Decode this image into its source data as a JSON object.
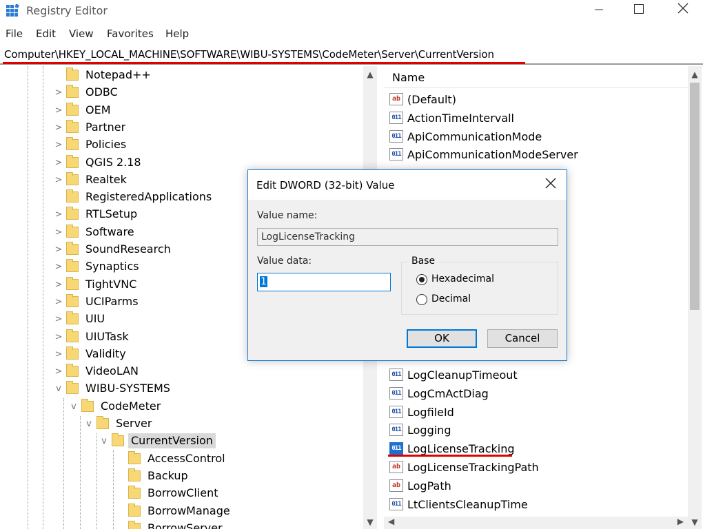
{
  "window": {
    "title": "Registry Editor"
  },
  "menu": [
    "File",
    "Edit",
    "View",
    "Favorites",
    "Help"
  ],
  "address": "Computer\\HKEY_LOCAL_MACHINE\\SOFTWARE\\WIBU-SYSTEMS\\CodeMeter\\Server\\CurrentVersion",
  "tree": {
    "items": [
      {
        "label": "Notepad++",
        "expander": ""
      },
      {
        "label": "ODBC",
        "expander": ">"
      },
      {
        "label": "OEM",
        "expander": ">"
      },
      {
        "label": "Partner",
        "expander": ">"
      },
      {
        "label": "Policies",
        "expander": ">"
      },
      {
        "label": "QGIS 2.18",
        "expander": ">"
      },
      {
        "label": "Realtek",
        "expander": ">"
      },
      {
        "label": "RegisteredApplications",
        "expander": ""
      },
      {
        "label": "RTLSetup",
        "expander": ">"
      },
      {
        "label": "Software",
        "expander": ">"
      },
      {
        "label": "SoundResearch",
        "expander": ">"
      },
      {
        "label": "Synaptics",
        "expander": ">"
      },
      {
        "label": "TightVNC",
        "expander": ">"
      },
      {
        "label": "UCIParms",
        "expander": ">"
      },
      {
        "label": "UIU",
        "expander": ">"
      },
      {
        "label": "UIUTask",
        "expander": ">"
      },
      {
        "label": "Validity",
        "expander": ">"
      },
      {
        "label": "VideoLAN",
        "expander": ">"
      },
      {
        "label": "WIBU-SYSTEMS",
        "expander": "v"
      },
      {
        "label": "CodeMeter",
        "expander": "v"
      },
      {
        "label": "Server",
        "expander": "v"
      },
      {
        "label": "CurrentVersion",
        "expander": "v",
        "selected": true
      },
      {
        "label": "AccessControl",
        "expander": ""
      },
      {
        "label": "Backup",
        "expander": ""
      },
      {
        "label": "BorrowClient",
        "expander": ""
      },
      {
        "label": "BorrowManage",
        "expander": ""
      },
      {
        "label": "BorrowServer",
        "expander": ""
      }
    ]
  },
  "list": {
    "header_name": "Name",
    "top_items": [
      {
        "name": "(Default)",
        "icon": "string-value-icon",
        "glyph": "ab"
      },
      {
        "name": "ActionTimeIntervall",
        "icon": "binary-value-icon",
        "glyph": "011"
      },
      {
        "name": "ApiCommunicationMode",
        "icon": "binary-value-icon",
        "glyph": "011"
      },
      {
        "name": "ApiCommunicationModeServer",
        "icon": "binary-value-icon",
        "glyph": "011"
      }
    ],
    "bottom_items": [
      {
        "name": "LogCleanupTimeout",
        "icon": "binary-value-icon",
        "glyph": "011"
      },
      {
        "name": "LogCmActDiag",
        "icon": "binary-value-icon",
        "glyph": "011"
      },
      {
        "name": "LogfileId",
        "icon": "binary-value-icon",
        "glyph": "011"
      },
      {
        "name": "Logging",
        "icon": "binary-value-icon",
        "glyph": "011"
      },
      {
        "name": "LogLicenseTracking",
        "icon": "binary-value-icon",
        "glyph": "011",
        "selected": true
      },
      {
        "name": "LogLicenseTrackingPath",
        "icon": "string-value-icon",
        "glyph": "ab"
      },
      {
        "name": "LogPath",
        "icon": "string-value-icon",
        "glyph": "ab"
      },
      {
        "name": "LtClientsCleanupTime",
        "icon": "binary-value-icon",
        "glyph": "011"
      }
    ]
  },
  "dialog": {
    "title": "Edit DWORD (32-bit) Value",
    "value_name_label": "Value name:",
    "value_name": "LogLicenseTracking",
    "value_data_label": "Value data:",
    "value_data": "1",
    "base_label": "Base",
    "radio_hex": "Hexadecimal",
    "radio_dec": "Decimal",
    "selected_base": "Hexadecimal",
    "ok_label": "OK",
    "cancel_label": "Cancel"
  },
  "colors": {
    "annotation_red": "#e00000",
    "accent_blue": "#0078d7"
  }
}
